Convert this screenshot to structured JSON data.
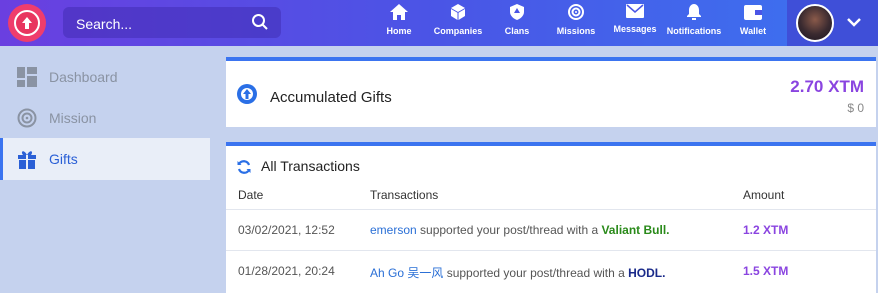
{
  "search": {
    "placeholder": "Search..."
  },
  "nav": [
    {
      "label": "Home",
      "icon": "home-icon"
    },
    {
      "label": "Companies",
      "icon": "cube-icon"
    },
    {
      "label": "Clans",
      "icon": "shield-icon"
    },
    {
      "label": "Missions",
      "icon": "target-icon"
    },
    {
      "label": "Messages",
      "icon": "envelope-icon"
    },
    {
      "label": "Notifications",
      "icon": "bell-icon"
    },
    {
      "label": "Wallet",
      "icon": "wallet-icon"
    }
  ],
  "sidebar": {
    "items": [
      {
        "label": "Dashboard",
        "icon": "dashboard-icon",
        "active": false
      },
      {
        "label": "Mission",
        "icon": "target-icon",
        "active": false
      },
      {
        "label": "Gifts",
        "icon": "gift-icon",
        "active": true
      }
    ]
  },
  "accumulated": {
    "title": "Accumulated Gifts",
    "amount": "2.70 XTM",
    "usd": "$ 0"
  },
  "transactions": {
    "title": "All Transactions",
    "headers": {
      "date": "Date",
      "transactions": "Transactions",
      "amount": "Amount"
    },
    "rows": [
      {
        "date": "03/02/2021, 12:52",
        "user": "emerson",
        "text": " supported your post/thread with a ",
        "gift": "Valiant Bull.",
        "amount": "1.2 XTM"
      },
      {
        "date": "01/28/2021, 20:24",
        "user": "Ah Go 吴一风",
        "text": " supported your post/thread with a ",
        "gift": "HODL.",
        "amount": "1.5 XTM"
      }
    ]
  },
  "colors": {
    "accent": "#3b74f0",
    "purple": "#8a44e0",
    "brand_red": "#ef3d6c"
  }
}
